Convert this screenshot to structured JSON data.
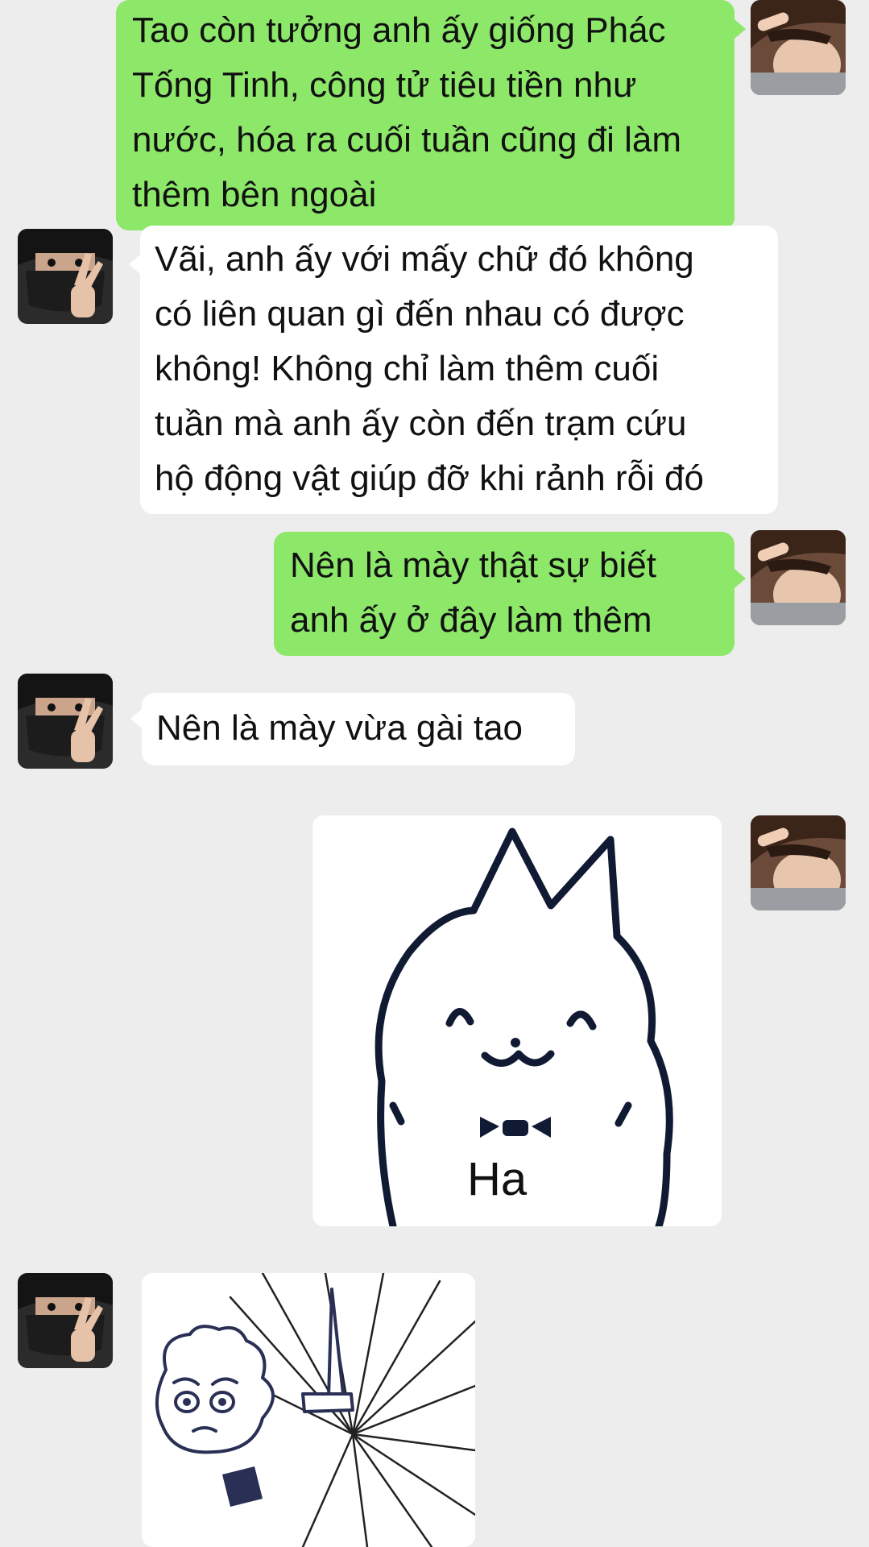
{
  "messages": [
    {
      "sender": "me",
      "type": "text",
      "lines": [
        "Tao còn tưởng anh ấy giống Phác",
        "Tống Tinh, công tử tiêu tiền như",
        "nước, hóa ra cuối tuần cũng đi làm",
        "thêm bên ngoài"
      ]
    },
    {
      "sender": "friend",
      "type": "text",
      "lines": [
        "Vãi, anh ấy với mấy chữ đó không",
        "có liên quan gì đến nhau có được",
        "không! Không chỉ làm thêm cuối",
        "tuần mà anh ấy còn đến trạm cứu",
        "hộ động vật giúp đỡ khi rảnh rỗi đó"
      ]
    },
    {
      "sender": "me",
      "type": "text",
      "lines": [
        "Nên là mày thật sự biết",
        "anh ấy ở đây làm thêm"
      ]
    },
    {
      "sender": "friend",
      "type": "text",
      "lines": [
        "Nên là mày vừa gài tao"
      ]
    },
    {
      "sender": "me",
      "type": "sticker",
      "sticker_name": "cat-laughing-sticker",
      "caption": "Ha"
    },
    {
      "sender": "friend",
      "type": "sticker",
      "sticker_name": "crying-knife-sticker"
    }
  ],
  "colors": {
    "background": "#ededed",
    "my_bubble": "#8de86a",
    "friend_bubble": "#ffffff",
    "text": "#111111"
  }
}
